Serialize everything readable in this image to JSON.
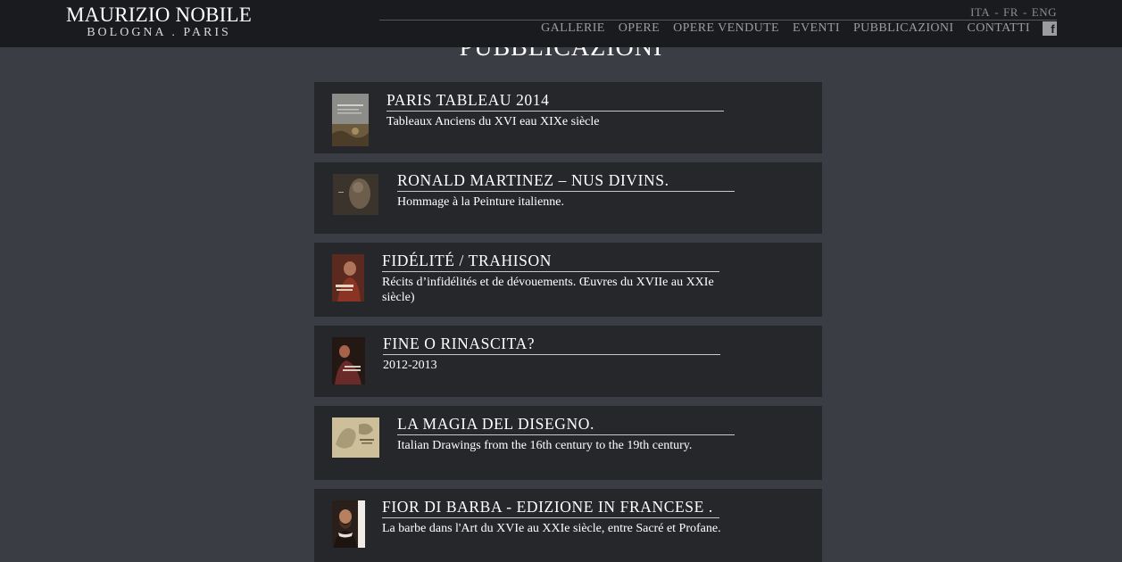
{
  "header": {
    "logo_name": "MAURIZIO NOBILE",
    "logo_city": "BOLOGNA . PARIS",
    "languages": [
      "ITA",
      "-",
      "FR",
      "-",
      "ENG"
    ],
    "nav": [
      "GALLERIE",
      "OPERE",
      "OPERE VENDUTE",
      "EVENTI",
      "PUBBLICAZIONI",
      "CONTATTI"
    ],
    "facebook_icon": "facebook-icon"
  },
  "page_title": "PUBBLICAZIONI",
  "publications": [
    {
      "title": "PARIS TABLEAU 2014",
      "desc": "Tableaux Anciens du XVI eau XIXe siècle"
    },
    {
      "title": "RONALD MARTINEZ – NUS DIVINS.",
      "desc": "Hommage à la Peinture italienne."
    },
    {
      "title": "FIDÉLITÉ / TRAHISON",
      "desc": "Récits d’infidélités et de dévouements. Œuvres du XVIIe au XXIe siècle)"
    },
    {
      "title": "FINE O RINASCITA?",
      "desc": "2012-2013"
    },
    {
      "title": "LA MAGIA DEL DISEGNO.",
      "desc": "Italian Drawings from the 16th century to the 19th century."
    },
    {
      "title": "FIOR DI BARBA - EDIZIONE IN FRANCESE .",
      "desc": "La barbe dans l'Art du XVIe au XXIe siècle, entre Sacré et Profane."
    }
  ]
}
